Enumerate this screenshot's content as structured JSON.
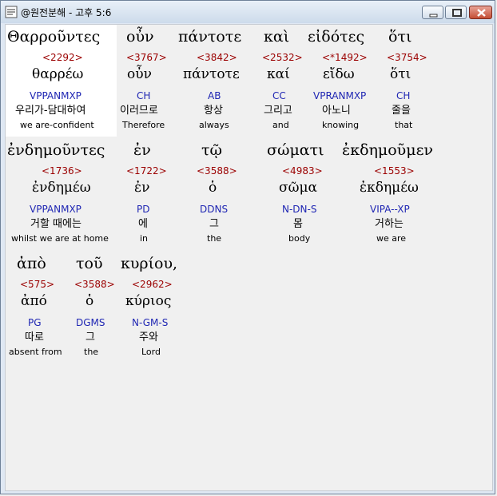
{
  "window": {
    "title": "@원전분해 - 고후 5:6"
  },
  "words": [
    {
      "greek": "Θαρροῦντες",
      "strong": "<2292>",
      "lemma": "θαρρέω",
      "morph": "VPPANMXP",
      "korean": "우리가-담대하여",
      "english": "we are-confident"
    },
    {
      "greek": "οὖν",
      "strong": "<3767>",
      "lemma": "οὖν",
      "morph": "CH",
      "korean": "이러므로",
      "english": "Therefore"
    },
    {
      "greek": "πάντοτε",
      "strong": "<3842>",
      "lemma": "πάντοτε",
      "morph": "AB",
      "korean": "항상",
      "english": "always"
    },
    {
      "greek": "καὶ",
      "strong": "<2532>",
      "lemma": "καί",
      "morph": "CC",
      "korean": "그리고",
      "english": "and"
    },
    {
      "greek": "εἰδότες",
      "strong": "<*1492>",
      "lemma": "εἴδω",
      "morph": "VPRANMXP",
      "korean": "아노니",
      "english": "knowing"
    },
    {
      "greek": "ὅτι",
      "strong": "<3754>",
      "lemma": "ὅτι",
      "morph": "CH",
      "korean": "줄을",
      "english": "that"
    },
    {
      "greek": "ἐνδημοῦντες",
      "strong": "<1736>",
      "lemma": "ἐνδημέω",
      "morph": "VPPANMXP",
      "korean": "거할 때에는",
      "english": "whilst we are at home"
    },
    {
      "greek": "ἐν",
      "strong": "<1722>",
      "lemma": "ἐν",
      "morph": "PD",
      "korean": "에",
      "english": "in"
    },
    {
      "greek": "τῷ",
      "strong": "<3588>",
      "lemma": "ὁ",
      "morph": "DDNS",
      "korean": "그",
      "english": "the"
    },
    {
      "greek": "σώματι",
      "strong": "<4983>",
      "lemma": "σῶμα",
      "morph": "N-DN-S",
      "korean": "몸",
      "english": "body"
    },
    {
      "greek": "ἐκδημοῦμεν",
      "strong": "<1553>",
      "lemma": "ἐκδημέω",
      "morph": "VIPA--XP",
      "korean": "거하는",
      "english": "we are"
    },
    {
      "greek": "ἀπὸ",
      "strong": "<575>",
      "lemma": "ἀπό",
      "morph": "PG",
      "korean": "따로",
      "english": "absent from"
    },
    {
      "greek": "τοῦ",
      "strong": "<3588>",
      "lemma": "ὁ",
      "morph": "DGMS",
      "korean": "그",
      "english": "the"
    },
    {
      "greek": "κυρίου,",
      "strong": "<2962>",
      "lemma": "κύριος",
      "morph": "N-GM-S",
      "korean": "주와",
      "english": "Lord"
    }
  ]
}
